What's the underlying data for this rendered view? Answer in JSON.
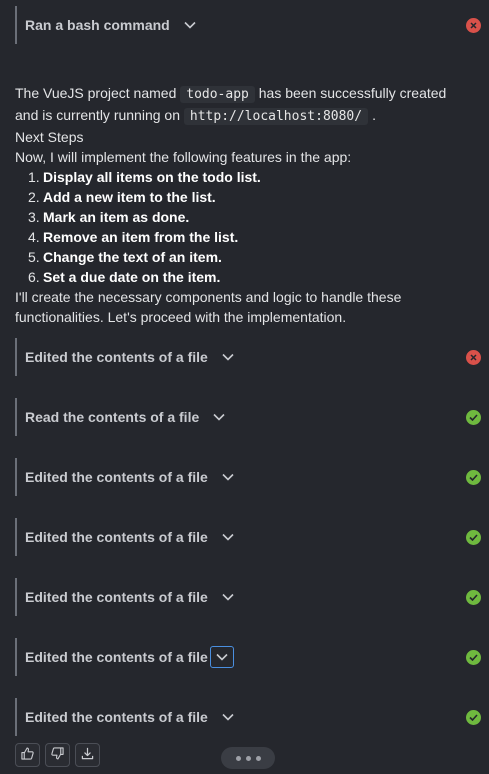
{
  "actions": [
    {
      "title": "Ran a bash command",
      "status": "error"
    },
    {
      "title": "Edited the contents of a file",
      "status": "error"
    },
    {
      "title": "Read the contents of a file",
      "status": "success"
    },
    {
      "title": "Edited the contents of a file",
      "status": "success"
    },
    {
      "title": "Edited the contents of a file",
      "status": "success"
    },
    {
      "title": "Edited the contents of a file",
      "status": "success"
    },
    {
      "title": "Edited the contents of a file",
      "status": "success"
    },
    {
      "title": "Edited the contents of a file",
      "status": "success"
    }
  ],
  "message": {
    "intro_prefix": "The VueJS project named",
    "project_name": "todo-app",
    "intro_middle_1": "has been successfully created",
    "intro_middle_2": "and is currently running on",
    "url": "http://localhost:8080/",
    "intro_suffix": ".",
    "next_steps_heading": "Next Steps",
    "features_intro": "Now, I will implement the following features in the app:",
    "steps": [
      {
        "num": "1.",
        "text": "Display all items on the todo list."
      },
      {
        "num": "2.",
        "text": "Add a new item to the list."
      },
      {
        "num": "3.",
        "text": "Mark an item as done."
      },
      {
        "num": "4.",
        "text": "Remove an item from the list."
      },
      {
        "num": "5.",
        "text": "Change the text of an item."
      },
      {
        "num": "6.",
        "text": "Set a due date on the item."
      }
    ],
    "closing_line_1": "I'll create the necessary components and logic to handle these",
    "closing_line_2": "functionalities. Let's proceed with the implementation."
  },
  "icons": {
    "chevron": "chevron-down-icon",
    "error": "error-x-icon",
    "success": "check-circle-icon",
    "thumbs_up": "thumbs-up-icon",
    "thumbs_down": "thumbs-down-icon",
    "download": "download-icon",
    "more": "more-dots-icon"
  },
  "colors": {
    "background": "#25272d",
    "error": "#d9514a",
    "success": "#6fb93f",
    "focus": "#4a8fe0"
  }
}
